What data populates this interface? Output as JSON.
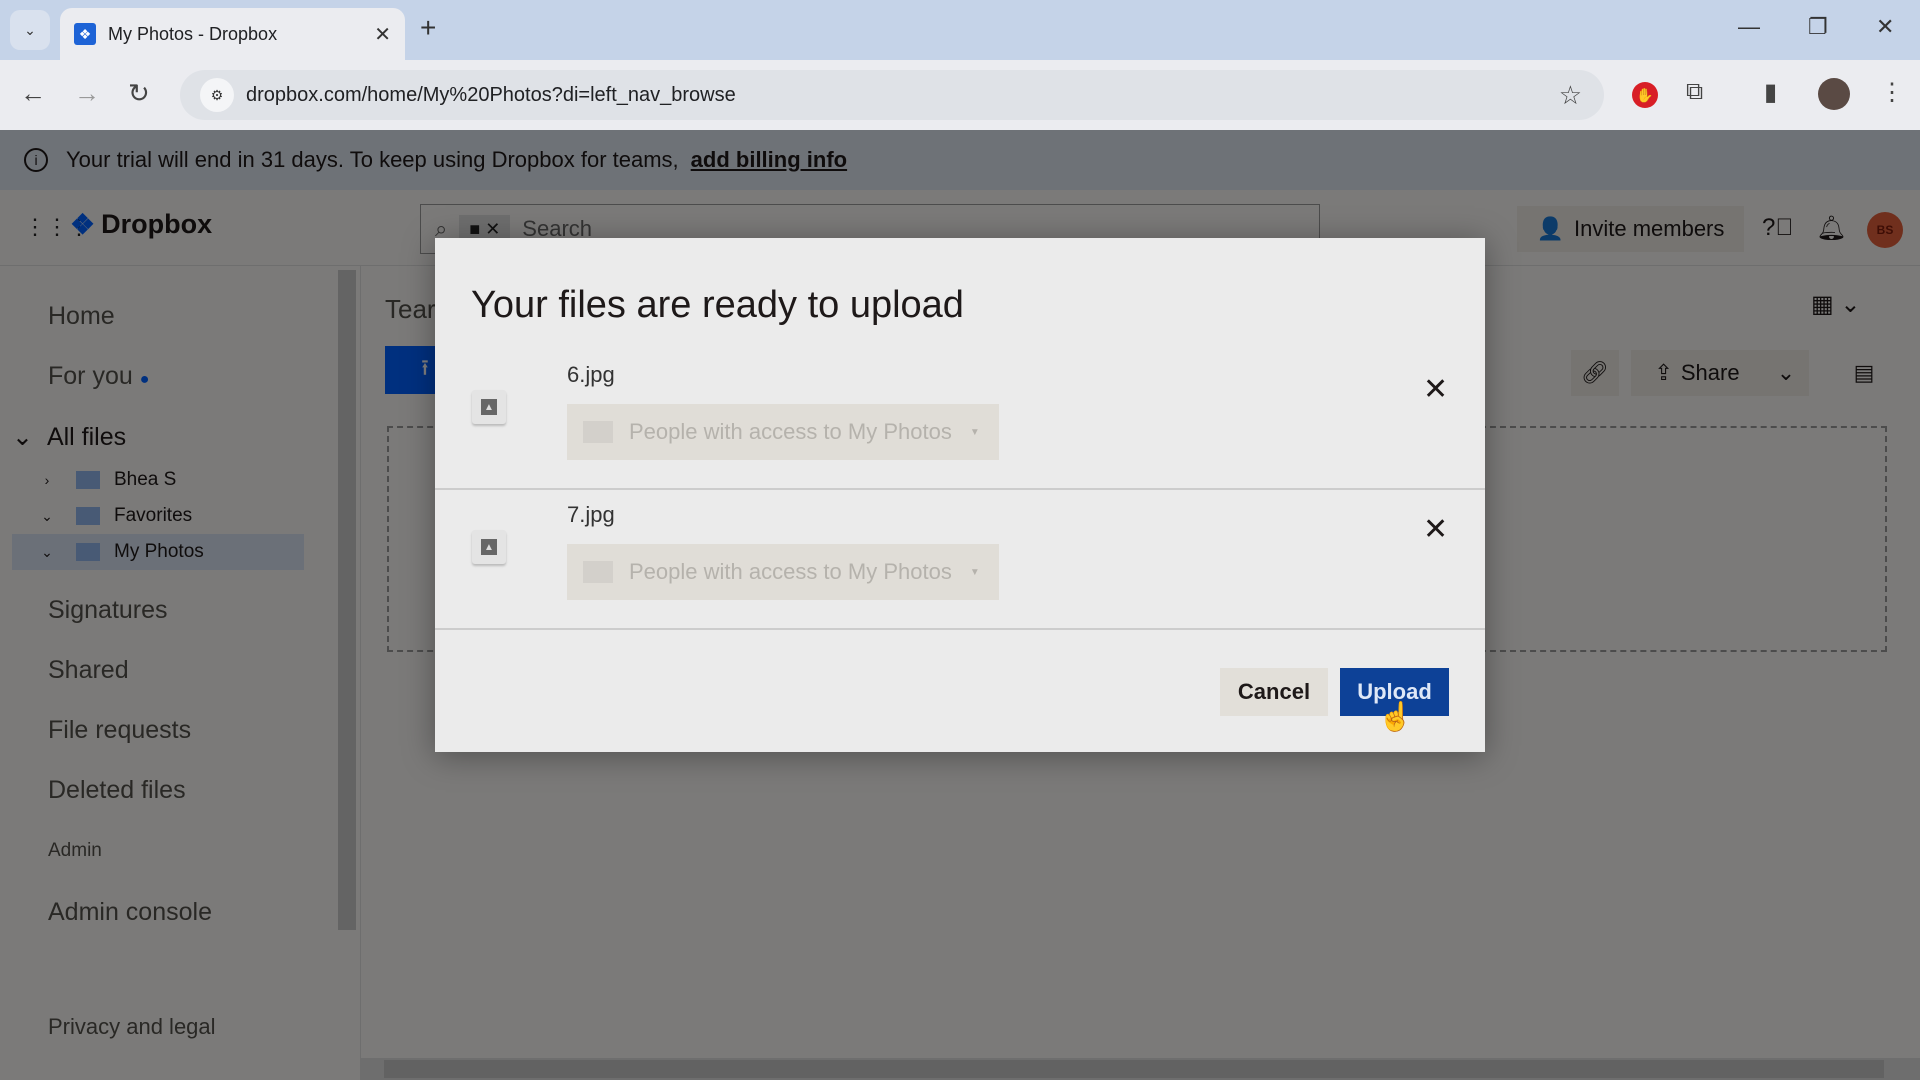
{
  "browser": {
    "tab_title": "My Photos - Dropbox",
    "url": "dropbox.com/home/My%20Photos?di=left_nav_browse"
  },
  "banner": {
    "text": "Your trial will end in 31 days. To keep using Dropbox for teams,",
    "link": "add billing info"
  },
  "header": {
    "brand": "Dropbox",
    "search_placeholder": "Search",
    "invite_label": "Invite members",
    "avatar_initials": "BS"
  },
  "sidebar": {
    "home": "Home",
    "for_you": "For you",
    "all_files": "All files",
    "tree": [
      {
        "label": "Bhea S",
        "expanded": false
      },
      {
        "label": "Favorites",
        "expanded": true
      },
      {
        "label": "My Photos",
        "expanded": true,
        "selected": true
      }
    ],
    "signatures": "Signatures",
    "shared": "Shared",
    "file_requests": "File requests",
    "deleted_files": "Deleted files",
    "admin_heading": "Admin",
    "admin_console": "Admin console",
    "privacy": "Privacy and legal"
  },
  "main": {
    "title_partial": "Tear",
    "share_label": "Share"
  },
  "modal": {
    "title": "Your files are ready to upload",
    "files": [
      {
        "name": "6.jpg",
        "permission": "People with access to My Photos"
      },
      {
        "name": "7.jpg",
        "permission": "People with access to My Photos"
      }
    ],
    "cancel_label": "Cancel",
    "upload_label": "Upload"
  }
}
